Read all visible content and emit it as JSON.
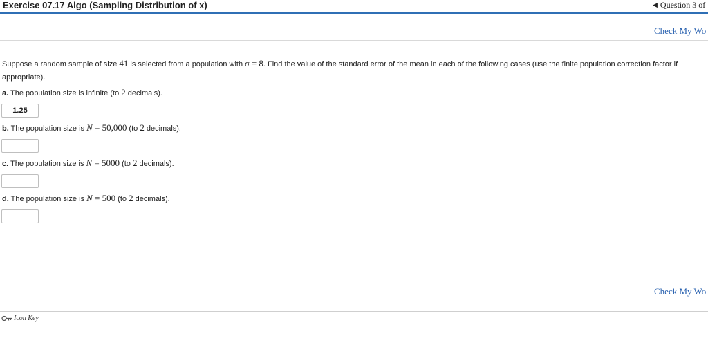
{
  "header": {
    "title": "Exercise 07.17 Algo (Sampling Distribution of x)",
    "nav_text": "Question 3 of"
  },
  "actions": {
    "check_label": "Check My Wo"
  },
  "problem": {
    "text1": "Suppose a random sample of size ",
    "n": "41",
    "text2": " is selected from a population with ",
    "sigma_sym": "σ",
    "sigma_eq": " = 8",
    "text3": ". Find the value of the standard error of the mean in each of the following cases (use the finite population correction factor if appropriate)."
  },
  "questions": {
    "a": {
      "letter": "a.",
      "pre": " The population size is infinite (to ",
      "n": "2",
      "post": " decimals).",
      "value": "1.25"
    },
    "b": {
      "letter": "b.",
      "pre": " The population size is ",
      "sym": "N",
      "eq": " = 50,000",
      "mid": " (to ",
      "n": "2",
      "post": " decimals).",
      "value": ""
    },
    "c": {
      "letter": "c.",
      "pre": " The population size is ",
      "sym": "N",
      "eq": " = 5000",
      "mid": " (to ",
      "n": "2",
      "post": " decimals).",
      "value": ""
    },
    "d": {
      "letter": "d.",
      "pre": " The population size is ",
      "sym": "N",
      "eq": " = 500",
      "mid": " (to ",
      "n": "2",
      "post": " decimals).",
      "value": ""
    }
  },
  "footer": {
    "icon_key_label": "Icon Key",
    "icon": "key-icon"
  },
  "colors": {
    "header_rule": "#2f6fb5",
    "link": "#2a62b0"
  }
}
